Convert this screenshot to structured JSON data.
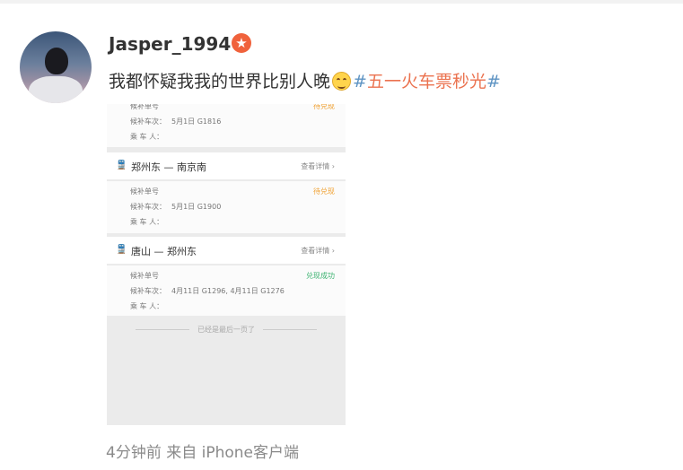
{
  "post": {
    "username": "Jasper_1994",
    "text_main": "我都怀疑我我的世界比别人晚",
    "hashtag_open": "#",
    "hashtag_text": "五一火车票秒光",
    "hashtag_close": "#",
    "footer": "4分钟前  来自 iPhone客户端"
  },
  "screenshot": {
    "top_section": {
      "order_label": "候补单号",
      "status": "待兑现",
      "train_label": "候补车次：",
      "train_value": "5月1日 G1816",
      "passenger_label": "乘 车 人："
    },
    "orders": [
      {
        "route": "郑州东 — 南京南",
        "details": "查看详情 ›",
        "order_label": "候补单号",
        "status": "待兑现",
        "status_color": "#f0a030",
        "train_label": "候补车次：",
        "train_value": "5月1日 G1900",
        "passenger_label": "乘 车 人："
      },
      {
        "route": "唐山 — 郑州东",
        "details": "查看详情 ›",
        "order_label": "候补单号",
        "status": "兑现成功",
        "status_color": "#3cb371",
        "train_label": "候补车次：",
        "train_value": "4月11日 G1296,  4月11日 G1276",
        "passenger_label": "乘 车 人："
      }
    ],
    "end_text": "已经是最后一页了"
  },
  "colors": {
    "hashtag": "#eb7350",
    "hashmark": "#5d93c3",
    "username": "#333333"
  }
}
